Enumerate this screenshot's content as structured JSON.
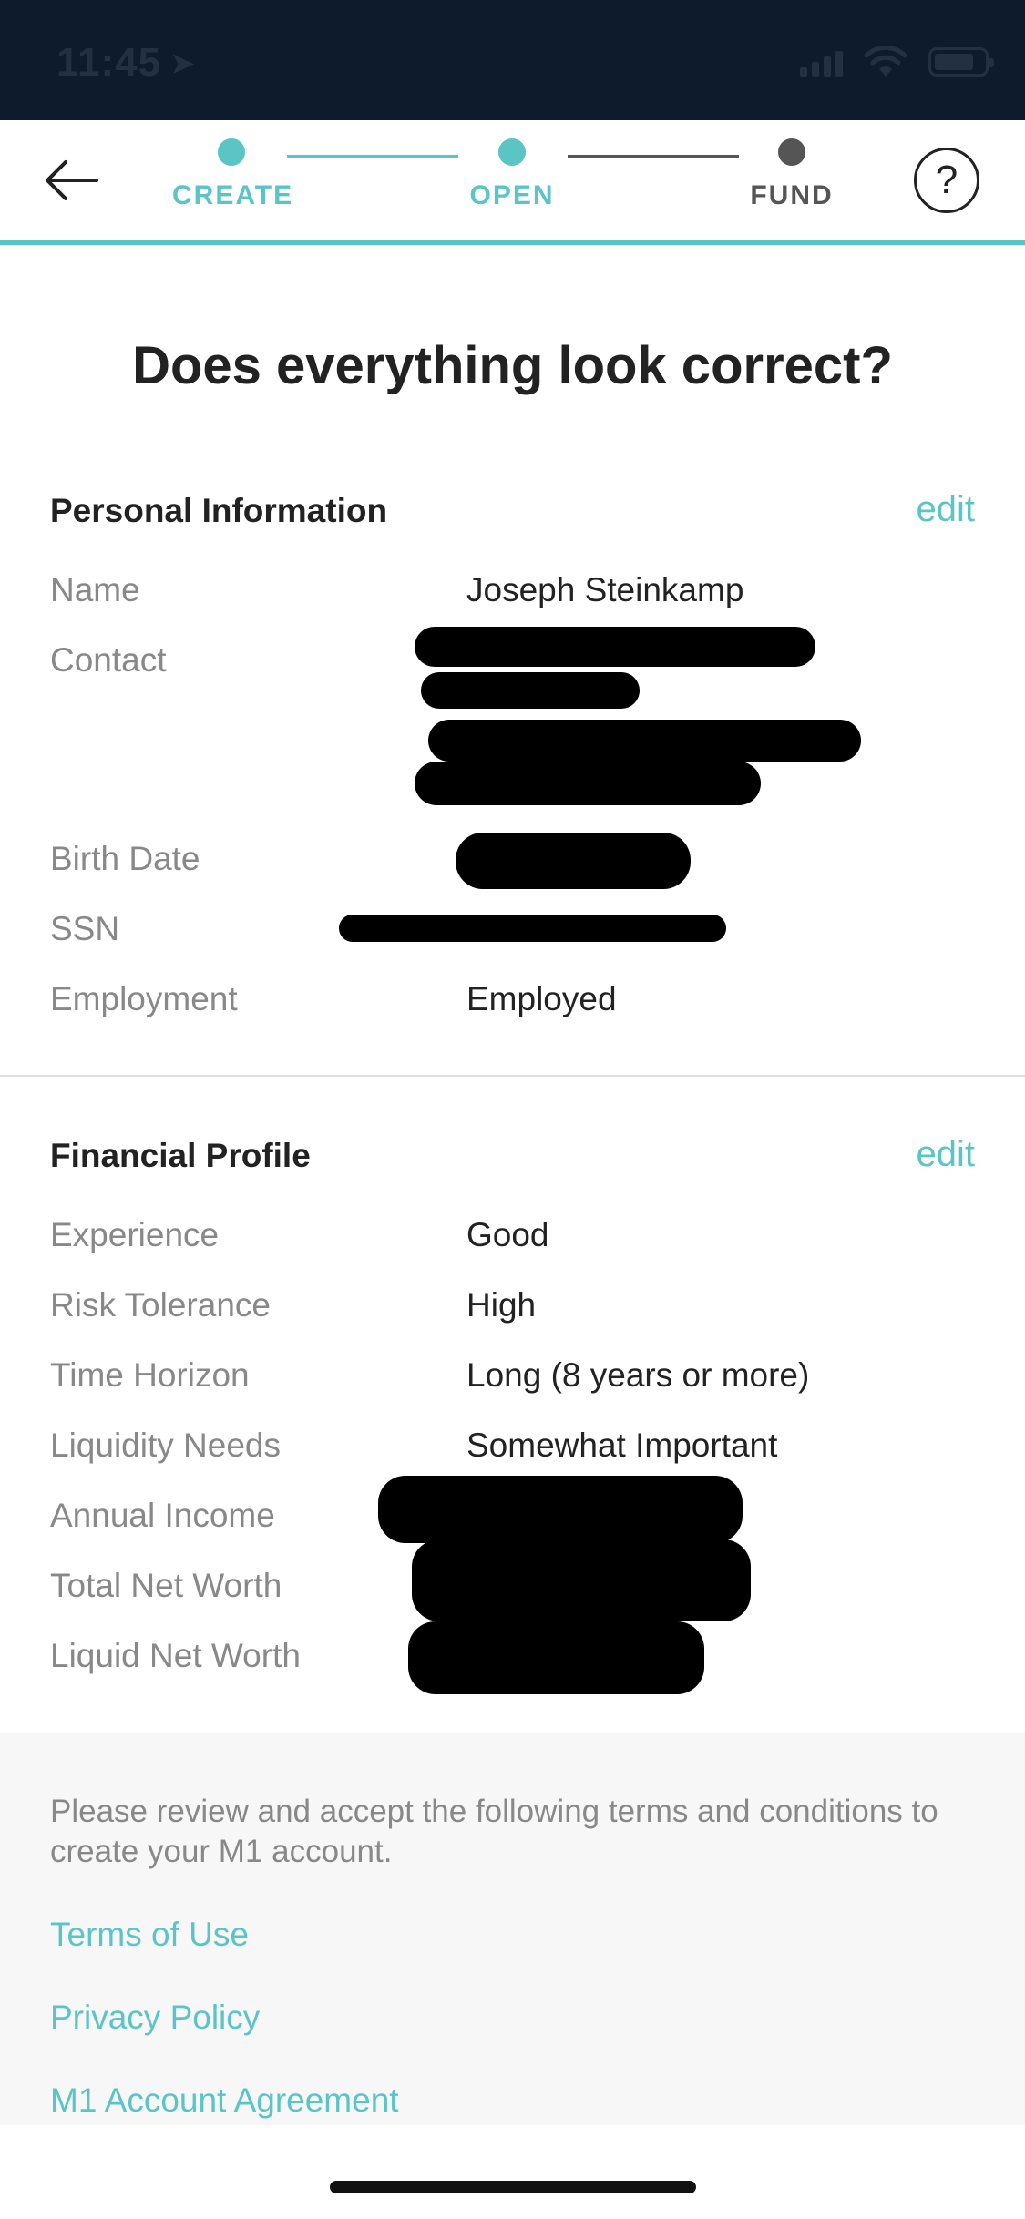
{
  "status_bar": {
    "time": "11:45",
    "location_icon": "location-arrow-icon"
  },
  "header": {
    "steps": [
      {
        "label": "CREATE",
        "state": "complete"
      },
      {
        "label": "OPEN",
        "state": "complete"
      },
      {
        "label": "FUND",
        "state": "incomplete"
      }
    ],
    "help_label": "?"
  },
  "title": "Does everything look correct?",
  "personal": {
    "title": "Personal Information",
    "edit": "edit",
    "rows": [
      {
        "label": "Name",
        "value": "Joseph Steinkamp"
      },
      {
        "label": "Contact",
        "value": ""
      },
      {
        "label": "Birth Date",
        "value": ""
      },
      {
        "label": "SSN",
        "value": ""
      },
      {
        "label": "Employment",
        "value": "Employed"
      }
    ]
  },
  "financial": {
    "title": "Financial Profile",
    "edit": "edit",
    "rows": [
      {
        "label": "Experience",
        "value": "Good"
      },
      {
        "label": "Risk Tolerance",
        "value": "High"
      },
      {
        "label": "Time Horizon",
        "value": "Long (8 years or more)"
      },
      {
        "label": "Liquidity Needs",
        "value": "Somewhat Important"
      },
      {
        "label": "Annual Income",
        "value": ""
      },
      {
        "label": "Total Net Worth",
        "value": ""
      },
      {
        "label": "Liquid Net Worth",
        "value": ""
      }
    ]
  },
  "terms": {
    "text": "Please review and accept the following terms and conditions to create your M1 account.",
    "links": [
      "Terms of Use",
      "Privacy Policy",
      "M1 Account Agreement"
    ]
  },
  "colors": {
    "accent": "#5bc5c6",
    "status_bar": "#0e1b2c",
    "inactive_step": "#555555"
  }
}
